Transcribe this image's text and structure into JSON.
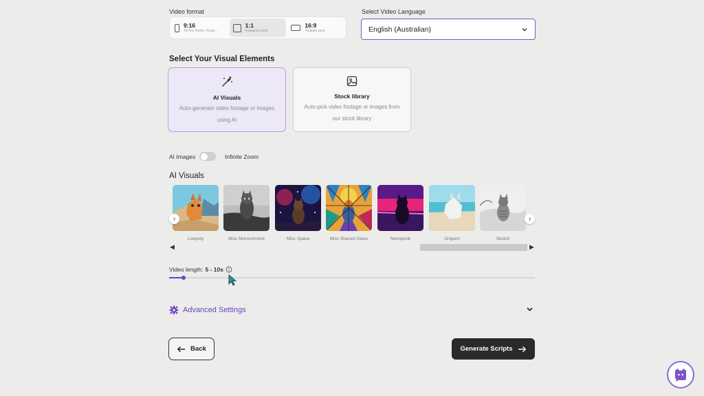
{
  "video_format": {
    "label": "Video format",
    "options": [
      {
        "title": "9:16",
        "subtitle": "TikTok, Reels, Youtu...",
        "selected": false
      },
      {
        "title": "1:1",
        "subtitle": "Instagram post",
        "selected": true
      },
      {
        "title": "16:9",
        "subtitle": "Youtube post",
        "selected": false
      }
    ]
  },
  "language": {
    "label": "Select Video Language",
    "value": "English (Australian)"
  },
  "visual_elements": {
    "title": "Select Your Visual Elements",
    "cards": [
      {
        "title": "AI Visuals",
        "desc": "Auto-generate video footage or images using AI",
        "icon": "magic-wand-icon",
        "selected": true
      },
      {
        "title": "Stock library",
        "desc": "Auto-pick video footage or images from our stock library",
        "icon": "image-icon",
        "selected": false
      }
    ]
  },
  "toggle_row": {
    "left_label": "AI Images",
    "right_label": "Infinite Zoom",
    "value": "AI Images"
  },
  "ai_visuals": {
    "title": "AI Visuals",
    "styles": [
      "Lowpoly",
      "Misc Monochrome",
      "Misc Space",
      "Misc Stained Glass",
      "Neonpunk",
      "Origami",
      "Sketch"
    ]
  },
  "video_length": {
    "label": "Video length:",
    "value": "5 - 10s",
    "slider_fraction": 0.04
  },
  "advanced": {
    "label": "Advanced Settings"
  },
  "buttons": {
    "back": "Back",
    "generate": "Generate Scripts"
  },
  "colors": {
    "accent": "#6d3fc0",
    "background": "#ececeb",
    "primary_button": "#2a2a2a"
  }
}
